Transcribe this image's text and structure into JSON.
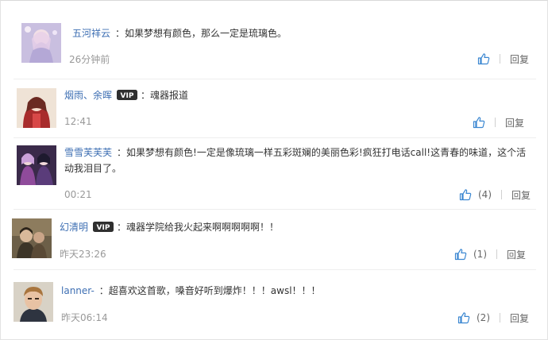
{
  "comments": [
    {
      "user": "五河祥云",
      "vip": false,
      "text": "如果梦想有颜色，那么一定是琉璃色。",
      "time": "26分钟前",
      "likes": "",
      "reply": "回复"
    },
    {
      "user": "烟雨、余晖",
      "vip": true,
      "vip_label": "VIP",
      "text": "魂器报道",
      "time": "12:41",
      "likes": "",
      "reply": "回复"
    },
    {
      "user": "雪雪芙芙芙",
      "vip": false,
      "text": "如果梦想有颜色!一定是像琉璃一样五彩斑斓的美丽色彩!疯狂打电话call!这青春的味道，这个活",
      "text_line2": "动我泪目了。",
      "time": "00:21",
      "likes": "(4)",
      "reply": "回复"
    },
    {
      "user": "幻清明",
      "vip": true,
      "vip_label": "VIP",
      "text": "魂器学院给我火起来啊啊啊啊啊！！",
      "time": "昨天23:26",
      "likes": "(1)",
      "reply": "回复"
    },
    {
      "user": "lanner-",
      "vip": false,
      "text": "超喜欢这首歌，嗓音好听到爆炸！！！awsl！！！",
      "time": "昨天06:14",
      "likes": "(2)",
      "reply": "回复"
    }
  ],
  "colon": "：",
  "colors": {
    "username": "#3e6fb3",
    "time": "#999999",
    "like_icon": "#3b87d1",
    "text": "#333333"
  },
  "icons": {
    "like": "thumbs-up-icon",
    "vip": "vip-badge-icon"
  }
}
